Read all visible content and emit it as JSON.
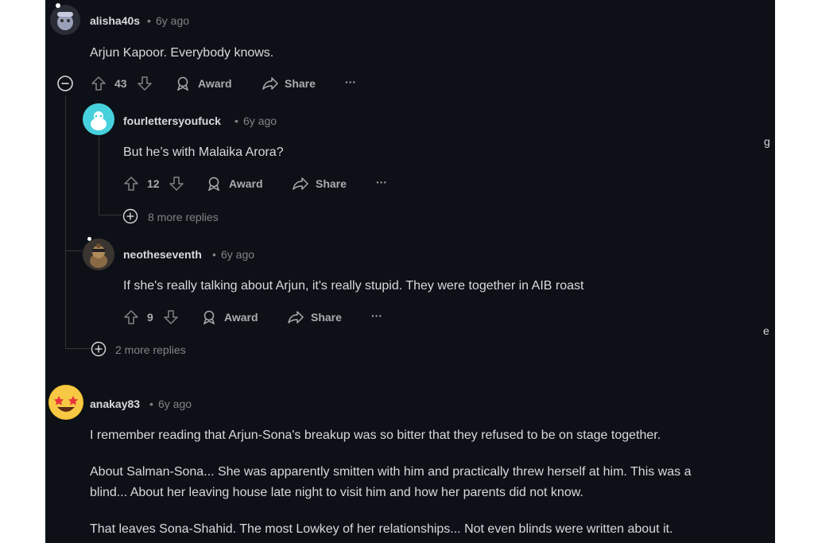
{
  "colors": {
    "background": "#0d1117",
    "text": "#d7dadc",
    "muted": "#818384"
  },
  "comments": [
    {
      "user": "alisha40s",
      "age": "6y ago",
      "text": "Arjun Kapoor. Everybody knows.",
      "votes": "43",
      "award": "Award",
      "share": "Share"
    },
    {
      "user": "fourlettersyoufuck",
      "age": "6y ago",
      "text": "But he’s with Malaika Arora?",
      "votes": "12",
      "award": "Award",
      "share": "Share",
      "more_replies": "8 more replies"
    },
    {
      "user": "neotheseventh",
      "age": "6y ago",
      "text": "If she's really talking about Arjun, it's really stupid. They were together in AIB roast",
      "votes": "9",
      "award": "Award",
      "share": "Share"
    },
    {
      "user": "anakay83",
      "age": "6y ago",
      "paragraphs": [
        "I remember reading that Arjun-Sona's breakup was so bitter that they refused to be on stage together.",
        "About Salman-Sona... She was apparently smitten with him and practically threw herself at him. This was a",
        "blind... About her leaving house late night to visit him and how her parents did not know.",
        "That leaves Sona-Shahid. The most Lowkey of her relationships... Not even blinds were written about it."
      ]
    }
  ],
  "thread_more_replies": "2 more replies",
  "dot": "•",
  "ellipsis": "···",
  "edge_glyphs": [
    "g",
    "e"
  ]
}
